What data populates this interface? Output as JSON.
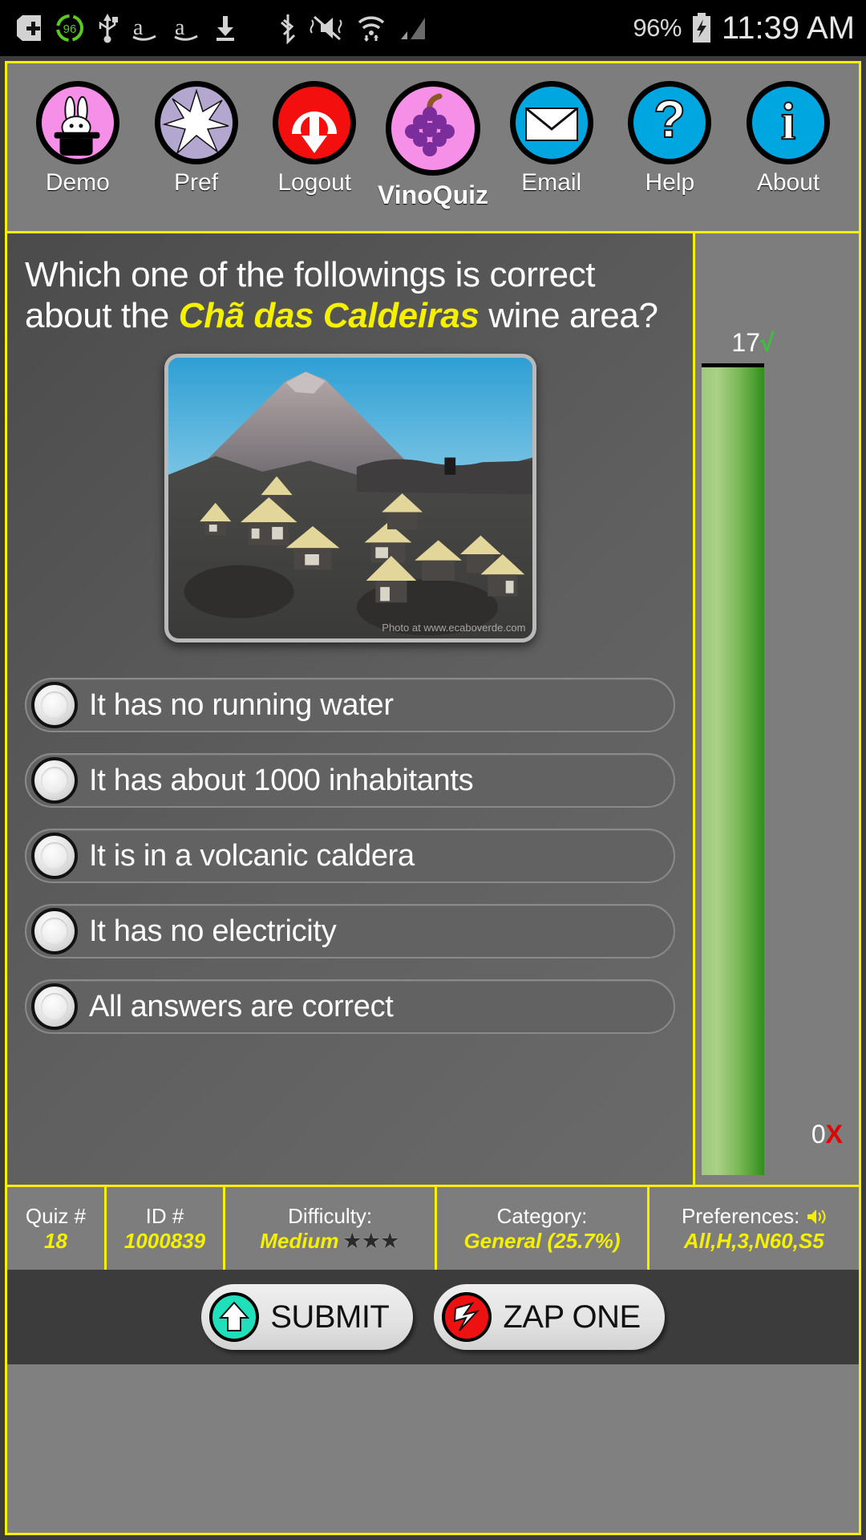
{
  "statusbar": {
    "icons": [
      "plus-box-icon",
      "score-96-badge-icon",
      "usb-icon",
      "amazon-a-icon",
      "amazon-a-icon",
      "download-icon",
      "bluetooth-icon",
      "mute-vibrate-icon",
      "wifi-icon",
      "cell-signal-icon"
    ],
    "battery_percent": "96%",
    "battery_icon": "battery-charging-icon",
    "time": "11:39 AM"
  },
  "toolbar": {
    "items": [
      {
        "label": "Demo",
        "icon": "magic-hat-rabbit-icon",
        "bold": false
      },
      {
        "label": "Pref",
        "icon": "star-burst-icon",
        "bold": false
      },
      {
        "label": "Logout",
        "icon": "power-down-arrow-icon",
        "bold": false
      },
      {
        "label": "VinoQuiz",
        "icon": "grapes-icon",
        "bold": true
      },
      {
        "label": "Email",
        "icon": "envelope-icon",
        "bold": false
      },
      {
        "label": "Help",
        "icon": "question-mark-icon",
        "bold": false
      },
      {
        "label": "About",
        "icon": "info-icon",
        "bold": false
      }
    ]
  },
  "question": {
    "prefix": "Which one of the followings is correct about the ",
    "highlight": "Chã das Caldeiras",
    "suffix": " wine area?",
    "image_credit": "Photo at www.ecaboverde.com",
    "image_alt": "volcano-village-photo"
  },
  "answers": [
    {
      "label": "It has no running water",
      "selected": false
    },
    {
      "label": "It has about 1000 inhabitants",
      "selected": false
    },
    {
      "label": "It is in a volcanic caldera",
      "selected": false
    },
    {
      "label": "It has no electricity",
      "selected": false
    },
    {
      "label": "All answers are correct",
      "selected": false
    }
  ],
  "score": {
    "correct": "17",
    "correct_mark": "√",
    "wrong": "0",
    "wrong_mark": "X",
    "bar_fill_percent": 100
  },
  "infobar": [
    {
      "key": "Quiz #",
      "value": "18",
      "stars": "",
      "icon": ""
    },
    {
      "key": "ID #",
      "value": "1000839",
      "stars": "",
      "icon": ""
    },
    {
      "key": "Difficulty:",
      "value": "Medium",
      "stars": "★★★",
      "icon": ""
    },
    {
      "key": "Category:",
      "value": "General (25.7%)",
      "stars": "",
      "icon": ""
    },
    {
      "key": "Preferences:",
      "value": "All,H,3,N60,S5",
      "stars": "",
      "icon": "speaker-icon"
    }
  ],
  "actions": [
    {
      "label": "SUBMIT",
      "icon": "up-arrow-icon"
    },
    {
      "label": "ZAP ONE",
      "icon": "lightning-bolt-icon"
    }
  ],
  "colors": {
    "frame_yellow": "#f5f000",
    "accent_yellow": "#f5f000",
    "panel_gray": "#7d7d7d",
    "bar_green": "#2f8f1c",
    "correct_green": "#3ac23a",
    "wrong_red": "#e30000"
  }
}
